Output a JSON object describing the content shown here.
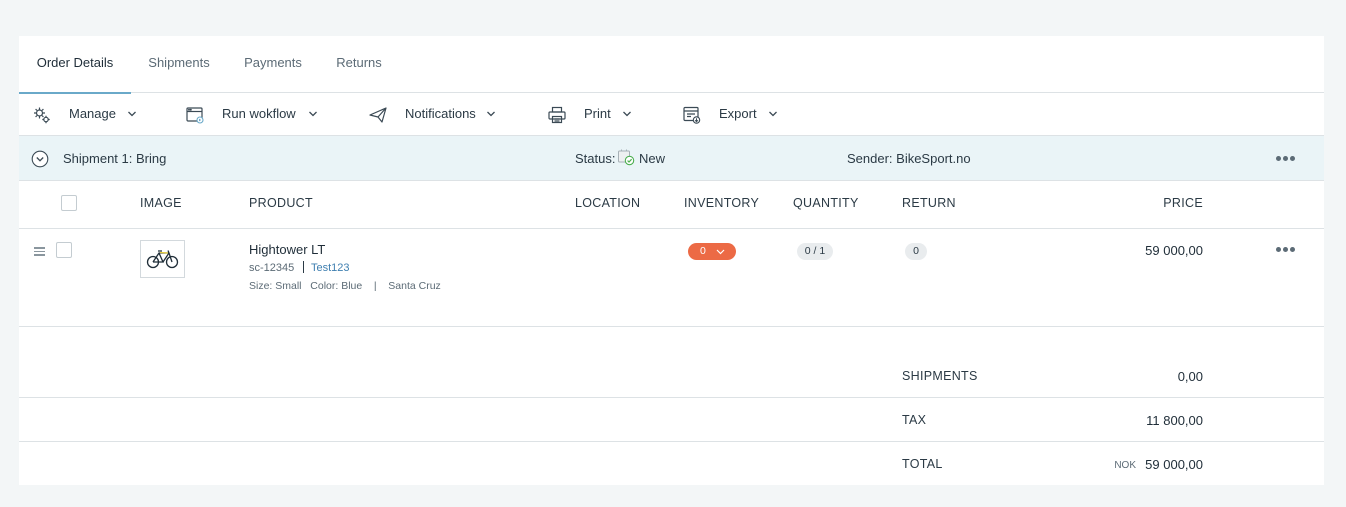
{
  "tabs": [
    {
      "label": "Order Details",
      "active": true
    },
    {
      "label": "Shipments",
      "active": false
    },
    {
      "label": "Payments",
      "active": false
    },
    {
      "label": "Returns",
      "active": false
    }
  ],
  "toolbar": {
    "manage": "Manage",
    "run_workflow": "Run wokflow",
    "notifications": "Notifications",
    "print": "Print",
    "export": "Export"
  },
  "shipment": {
    "title": "Shipment 1: Bring",
    "status_label": "Status:",
    "status_value": "New",
    "sender": "Sender: BikeSport.no"
  },
  "table": {
    "headers": {
      "image": "IMAGE",
      "product": "PRODUCT",
      "location": "LOCATION",
      "inventory": "INVENTORY",
      "quantity": "QUANTITY",
      "return": "RETURN",
      "price": "PRICE"
    },
    "rows": [
      {
        "name": "Hightower LT",
        "sku": "sc-12345",
        "link": "Test123",
        "attrs": "Size: Small   Color: Blue    |    Santa Cruz",
        "inventory": "0",
        "quantity": "0 / 1",
        "return": "0",
        "price": "59 000,00"
      }
    ]
  },
  "summary": {
    "shipments_label": "SHIPMENTS",
    "shipments_value": "0,00",
    "tax_label": "TAX",
    "tax_value": "11 800,00",
    "total_label": "TOTAL",
    "total_currency": "NOK",
    "total_value": "59 000,00"
  },
  "colors": {
    "accent": "#6aa9c9",
    "inventory_badge": "#ec6a45",
    "shipment_bar": "#eaf4f7",
    "link": "#3f7fb0"
  },
  "icons": {
    "manage": "gears-icon",
    "run_workflow": "window-icon",
    "notifications": "paper-plane-icon",
    "print": "printer-icon",
    "export": "export-icon"
  }
}
